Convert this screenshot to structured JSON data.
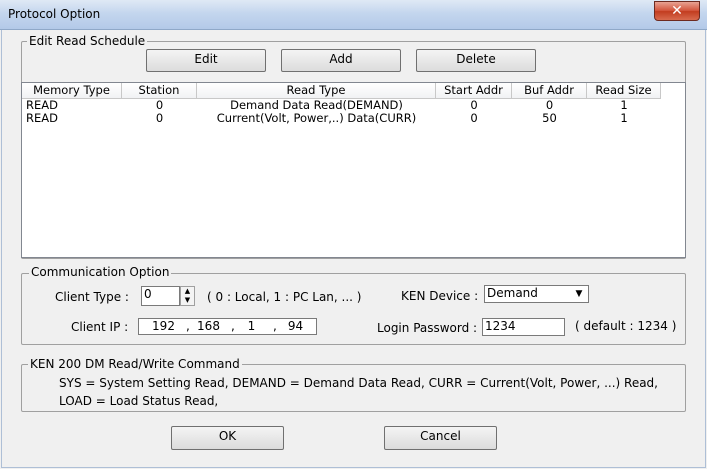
{
  "window": {
    "title": "Protocol Option",
    "close_label": "✕"
  },
  "schedule": {
    "legend": "Edit Read Schedule",
    "edit_label": "Edit",
    "add_label": "Add",
    "delete_label": "Delete",
    "columns": [
      "Memory Type",
      "Station",
      "Read Type",
      "Start Addr",
      "Buf Addr",
      "Read Size"
    ],
    "rows": [
      [
        "READ",
        "0",
        "Demand Data Read(DEMAND)",
        "0",
        "0",
        "1"
      ],
      [
        "READ",
        "0",
        "Current(Volt, Power,..) Data(CURR)",
        "0",
        "50",
        "1"
      ]
    ]
  },
  "comm": {
    "legend": "Communication Option",
    "client_type_label": "Client Type :",
    "client_type_value": "0",
    "client_type_hint": "( 0 : Local,  1 : PC Lan, ... )",
    "client_ip_label": "Client IP :",
    "ip": [
      "192",
      "168",
      "1",
      "94"
    ],
    "ken_device_label": "KEN Device :",
    "ken_device_value": "Demand",
    "login_password_label": "Login Password :",
    "login_password_value": "1234",
    "password_hint": "( default : 1234 )"
  },
  "commands": {
    "legend": "KEN 200 DM Read/Write Command",
    "line1": "SYS = System Setting Read, DEMAND = Demand Data Read, CURR = Current(Volt, Power, ...) Read,",
    "line2": "LOAD =  Load Status Read,"
  },
  "footer": {
    "ok_label": "OK",
    "cancel_label": "Cancel"
  }
}
